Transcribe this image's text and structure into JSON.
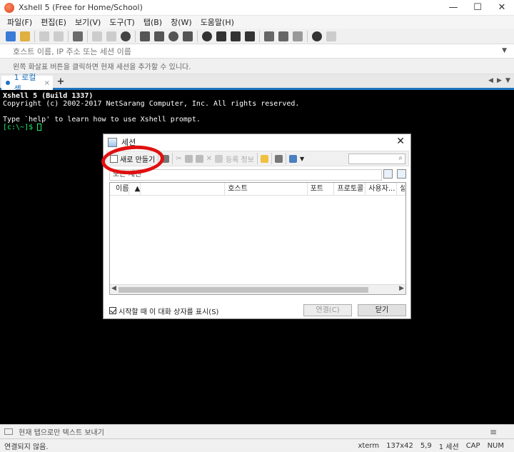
{
  "window": {
    "title": "Xshell 5 (Free for Home/School)",
    "minimize": "—",
    "maximize": "☐",
    "close": "✕"
  },
  "menu": [
    "파일(F)",
    "편집(E)",
    "보기(V)",
    "도구(T)",
    "탭(B)",
    "창(W)",
    "도움말(H)"
  ],
  "addressbar": {
    "placeholder": "호스트 이름, IP 주소 또는 세션 이름"
  },
  "infobar": {
    "text": "왼쪽 화살표 버튼을 클릭하면 현재 세션을 추가할 수 있니다."
  },
  "tabs": {
    "active_label": "1 로컬 셸",
    "close": "×",
    "add": "+"
  },
  "terminal": {
    "line1": "Xshell 5 (Build 1337)",
    "line2": "Copyright (c) 2002-2017 NetSarang Computer, Inc. All rights reserved.",
    "line3": "Type `help' to learn how to use Xshell prompt.",
    "prompt": "[c:\\~]$ "
  },
  "dialog": {
    "title": "세션",
    "new_button": "새로 만들기",
    "properties": "등록 정보",
    "path": "모든 세션",
    "columns": [
      "이름",
      "호스트",
      "포트",
      "프로토콜",
      "사용자...",
      "설"
    ],
    "show_on_start": "시작할 때 이 대화 상자를 표시(S)",
    "connect": "연결(C)",
    "close_btn": "닫기"
  },
  "sendbar": {
    "text": "현재 탭으로만 텍스트 보내기"
  },
  "status": {
    "left": "연결되지 않음.",
    "term": "xterm",
    "size": "137x42",
    "pos": "5,9",
    "sessions": "1 세션",
    "cap": "CAP",
    "num": "NUM"
  }
}
